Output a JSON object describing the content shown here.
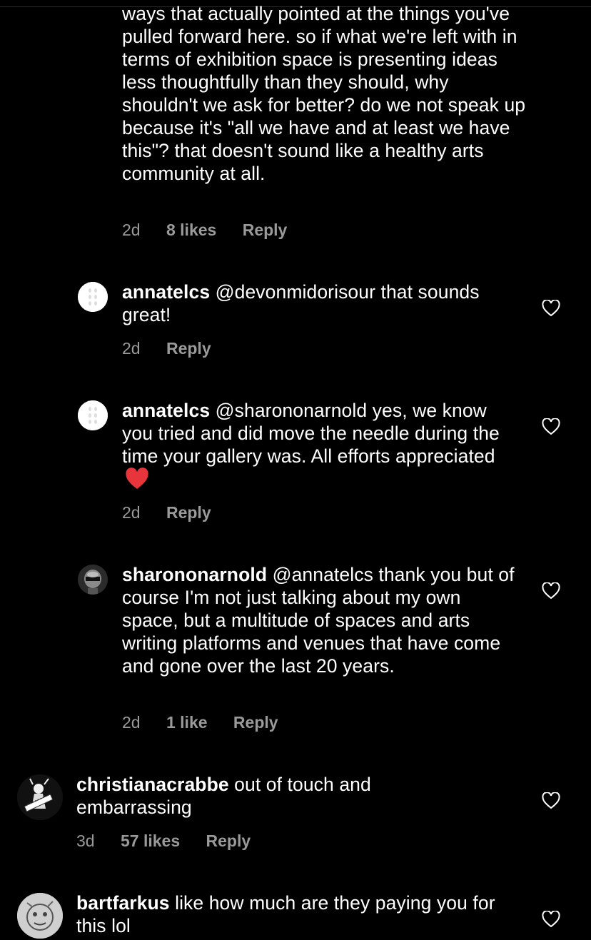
{
  "comments": [
    {
      "text": "ways that actually pointed at the things you've pulled forward here. so if what we're left with in terms of exhibition space is presenting ideas less thoughtfully than they should, why shouldn't we ask for better? do we not speak up because it's \"all we have and at least we have this\"? that doesn't sound like a healthy arts community at all.",
      "time": "2d",
      "likes": "8 likes",
      "reply": "Reply"
    },
    {
      "user": "annatelcs",
      "text": "@devonmidorisour that sounds great!",
      "time": "2d",
      "reply": "Reply",
      "avatar_icon": "pearl-strand-avatar"
    },
    {
      "user": "annatelcs",
      "text": "@sharononarnold yes, we know you tried and did move the needle during the time your gallery was. All efforts appreciated",
      "time": "2d",
      "reply": "Reply",
      "avatar_icon": "pearl-strand-avatar",
      "emoji": "red-heart-emoji"
    },
    {
      "user": "sharononarnold",
      "text": "@annatelcs thank you but of course I'm not just talking about my own space, but a multitude of spaces and arts writing platforms and venues that have come and gone over the last 20 years.",
      "time": "2d",
      "likes": "1 like",
      "reply": "Reply",
      "avatar_icon": "robot-helmet-avatar"
    },
    {
      "user": "christianacrabbe",
      "text": "out of touch and embarrassing",
      "time": "3d",
      "likes": "57 likes",
      "reply": "Reply",
      "avatar_icon": "keytar-figure-avatar"
    },
    {
      "user": "bartfarkus",
      "text": "like how much are they paying you for this lol",
      "avatar_icon": "sketch-face-avatar"
    }
  ],
  "colors": {
    "background": "#000000",
    "text": "#ffffff",
    "meta": "#9a9a9a",
    "heart_emoji": "#e8353b"
  },
  "icons": {
    "like": "heart-outline-icon"
  }
}
